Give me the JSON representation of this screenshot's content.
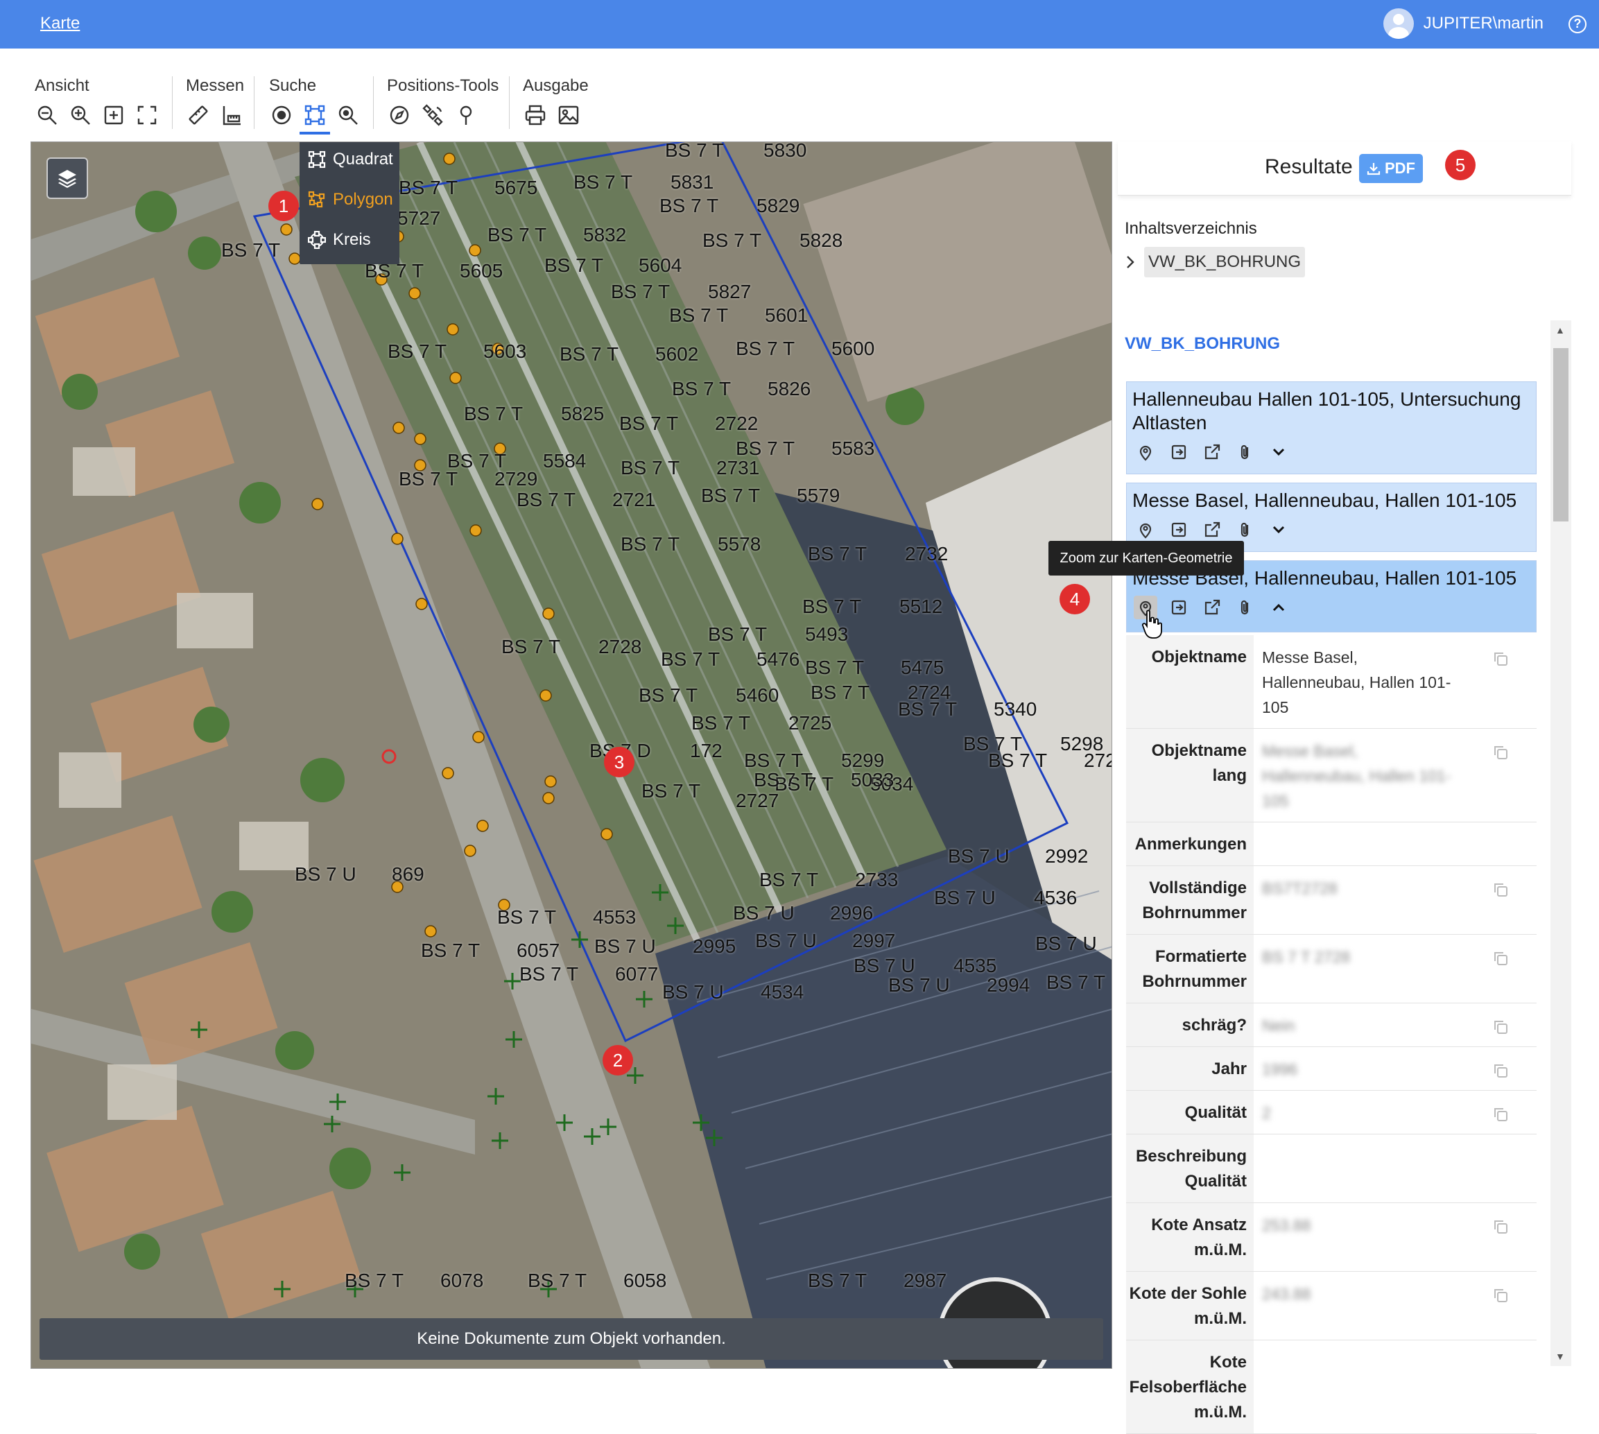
{
  "topbar": {
    "nav_link": "Karte",
    "user": "JUPITER\\martin",
    "help": "?",
    "bg_color": "#4a86e8"
  },
  "toolbar": {
    "groups": [
      {
        "label": "Ansicht",
        "icons": [
          "zoom-out-icon",
          "zoom-in-icon",
          "zoom-to-box-icon",
          "fullscreen-icon"
        ]
      },
      {
        "label": "Messen",
        "icons": [
          "measure-distance-icon",
          "measure-area-icon"
        ]
      },
      {
        "label": "Suche",
        "icons": [
          "search-point-icon",
          "search-square-icon",
          "search-zoom-icon"
        ]
      },
      {
        "label": "Positions-Tools",
        "icons": [
          "compass-icon",
          "satellite-icon",
          "location-pin-icon"
        ]
      },
      {
        "label": "Ausgabe",
        "icons": [
          "print-icon",
          "image-export-icon"
        ]
      }
    ]
  },
  "search_menu": {
    "items": [
      {
        "label": "Quadrat",
        "icon": "square-select-icon",
        "active": false
      },
      {
        "label": "Polygon",
        "icon": "polygon-select-icon",
        "active": true
      },
      {
        "label": "Kreis",
        "icon": "circle-select-icon",
        "active": false
      }
    ],
    "active_color": "#f0a020"
  },
  "badges": {
    "b1": "1",
    "b2": "2",
    "b3": "3",
    "b4": "4",
    "b5": "5"
  },
  "map": {
    "status": "Keine Dokumente zum Objekt vorhanden.",
    "labels": [
      "5830",
      "BS 7 T",
      "BS 7 T",
      "5675",
      "BS 7 T",
      "5831",
      "5727",
      "BS 7 T",
      "5829",
      "BS 7 T",
      "BS 7 T",
      "5832",
      "BS 7 T",
      "5828",
      "BS 7 T",
      "5605",
      "BS 7 T",
      "5604",
      "BS 7 T",
      "5827",
      "BS 7 T",
      "5601",
      "BS 7 T",
      "5603",
      "BS 7 T",
      "5602",
      "BS 7 T",
      "5600",
      "BS 7 T",
      "5826",
      "BS 7 T",
      "5825",
      "BS 7 T",
      "2722",
      "BS 7 T",
      "5583",
      "BS 7 T",
      "5584",
      "BS 7 T",
      "2731",
      "BS 7 T",
      "2729",
      "BS 7 T",
      "2721",
      "BS 7 T",
      "5579",
      "BS 7 T",
      "5578",
      "BS 7 T",
      "2732",
      "BS 7 T",
      "5512",
      "BS 7 T",
      "5493",
      "BS 7 T",
      "2728",
      "BS 7 T",
      "5476",
      "BS 7 T",
      "5475",
      "BS 7 T",
      "5460",
      "BS 7 T",
      "2724",
      "BS 7 T",
      "2725",
      "BS 7 T",
      "5340",
      "BS 7 D",
      "172",
      "BS 7 T",
      "5299",
      "BS 7 T",
      "5298",
      "BS 7 T",
      "2727",
      "BS 7 T",
      "5034",
      "BS 7 T",
      "272",
      "BS 7 T",
      "5033",
      "BS 7 U",
      "2992",
      "BS 7 U",
      "869",
      "BS 7 T",
      "2733",
      "BS 7 U",
      "4536",
      "BS 7 T",
      "4553",
      "BS 7 U",
      "2996",
      "BS 7 U",
      "2997",
      "BS 7 U",
      "BS 7 T",
      "6057",
      "BS 7 U",
      "2995",
      "BS 7 U",
      "4535",
      "BS 7 T",
      "6077",
      "BS 7 U",
      "4534",
      "BS 7 U",
      "2994",
      "BS 7 T",
      "BS 7 T",
      "6078",
      "BS 7 T",
      "6058",
      "BS 7 T",
      "2987"
    ]
  },
  "results": {
    "title": "Resultate",
    "pdf_label": "PDF",
    "toc_label": "Inhaltsverzeichnis",
    "toc_item": "VW_BK_BOHRUNG",
    "section_title": "VW_BK_BOHRUNG",
    "cards": [
      {
        "title": "Hallenneubau Hallen 101-105, Untersuchung Altlasten"
      },
      {
        "title": "Messe Basel, Hallenneubau, Hallen 101-105"
      },
      {
        "title": "Messe Basel, Hallenneubau, Hallen 101-105"
      }
    ],
    "tooltip": "Zoom zur Karten-Geometrie",
    "attributes": [
      {
        "key": "Objektname",
        "value": "Messe Basel, Hallenneubau, Hallen 101-105",
        "blur": false,
        "copy": true
      },
      {
        "key": "Objektname lang",
        "value": "Messe Basel, Hallenneubau, Hallen 101-105",
        "blur": true,
        "copy": true
      },
      {
        "key": "Anmerkungen",
        "value": "",
        "blur": false,
        "copy": false
      },
      {
        "key": "Vollständige Bohrnummer",
        "value": "BS7T2728",
        "blur": true,
        "copy": true
      },
      {
        "key": "Formatierte Bohrnummer",
        "value": "BS 7 T 2728",
        "blur": true,
        "copy": true
      },
      {
        "key": "schräg?",
        "value": "Nein",
        "blur": true,
        "copy": true
      },
      {
        "key": "Jahr",
        "value": "1996",
        "blur": true,
        "copy": true
      },
      {
        "key": "Qualität",
        "value": "2",
        "blur": true,
        "copy": true
      },
      {
        "key": "Beschreibung Qualität",
        "value": "",
        "blur": false,
        "copy": false
      },
      {
        "key": "Kote Ansatz m.ü.M.",
        "value": "253.88",
        "blur": true,
        "copy": true
      },
      {
        "key": "Kote der Sohle m.ü.M.",
        "value": "243.88",
        "blur": true,
        "copy": true
      },
      {
        "key": "Kote Felsoberfläche m.ü.M.",
        "value": "",
        "blur": false,
        "copy": false
      }
    ]
  }
}
